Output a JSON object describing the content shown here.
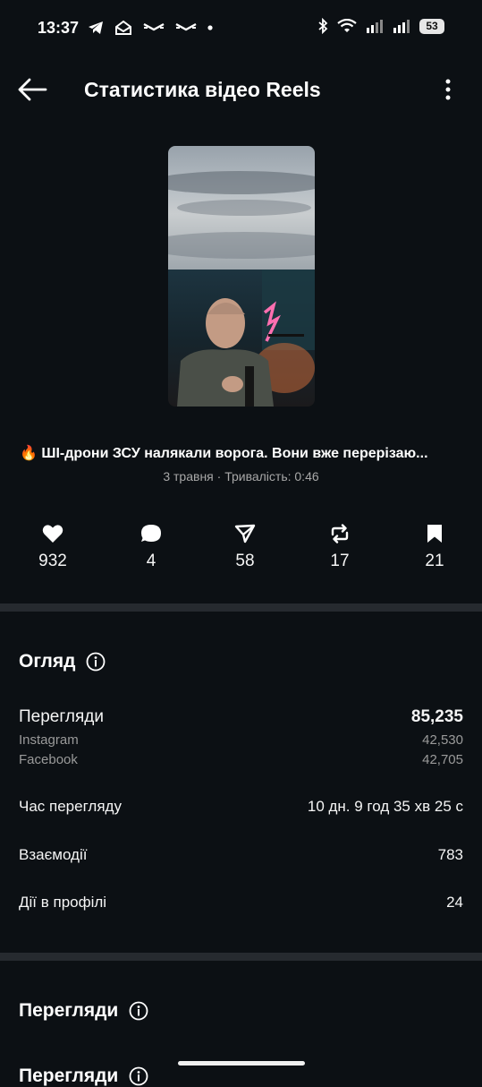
{
  "status_bar": {
    "time": "13:37",
    "battery": "53"
  },
  "header": {
    "title": "Статистика відео Reels"
  },
  "video": {
    "title": "🔥 ШІ-дрони ЗСУ налякали ворога. Вони вже перерізаю...",
    "meta": "3 травня · Тривалість: 0:46"
  },
  "stats": [
    {
      "icon": "heart-icon",
      "value": "932"
    },
    {
      "icon": "comment-icon",
      "value": "4"
    },
    {
      "icon": "share-icon",
      "value": "58"
    },
    {
      "icon": "repost-icon",
      "value": "17"
    },
    {
      "icon": "bookmark-icon",
      "value": "21"
    }
  ],
  "overview": {
    "title": "Огляд",
    "views_label": "Перегляди",
    "views_value": "85,235",
    "instagram_label": "Instagram",
    "instagram_value": "42,530",
    "facebook_label": "Facebook",
    "facebook_value": "42,705",
    "watch_time_label": "Час перегляду",
    "watch_time_value": "10 дн. 9 год 35 хв 25 с",
    "interactions_label": "Взаємодії",
    "interactions_value": "783",
    "profile_actions_label": "Дії в профілі",
    "profile_actions_value": "24"
  },
  "views_section": {
    "title": "Перегляди",
    "subtitle": "Перегляди"
  }
}
